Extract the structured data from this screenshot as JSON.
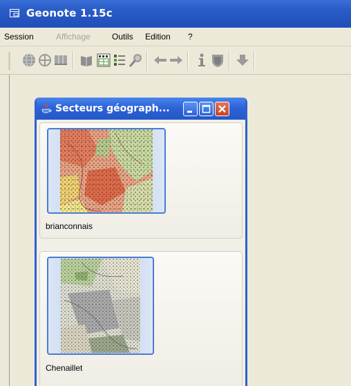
{
  "window": {
    "title": "Geonote 1.15c"
  },
  "menu": {
    "items": [
      {
        "label": "Session",
        "enabled": true
      },
      {
        "label": "Affichage",
        "enabled": false
      },
      {
        "label": "Outils",
        "enabled": true
      },
      {
        "label": "Edition",
        "enabled": true
      },
      {
        "label": "?",
        "enabled": true
      }
    ]
  },
  "toolbar": {
    "buttons": [
      {
        "icon": "globe-icon"
      },
      {
        "icon": "crosshair-icon"
      },
      {
        "icon": "columns-icon"
      },
      {
        "icon": "book-icon"
      },
      {
        "icon": "notes-grid-icon"
      },
      {
        "icon": "list-icon"
      },
      {
        "icon": "magnifier-icon"
      },
      {
        "icon": "arrow-left-icon"
      },
      {
        "icon": "arrow-right-icon"
      },
      {
        "icon": "info-icon"
      },
      {
        "icon": "shield-icon"
      },
      {
        "icon": "arrow-down-icon"
      }
    ]
  },
  "internal_frame": {
    "title": "Secteurs géograph...",
    "sectors": [
      {
        "label": "brianconnais",
        "selected": true
      },
      {
        "label": "Chenaillet",
        "selected": false
      }
    ]
  },
  "colors": {
    "title_bar": "#2a5cc8",
    "frame_border": "#2f5fcf",
    "close_button": "#d2542f"
  }
}
